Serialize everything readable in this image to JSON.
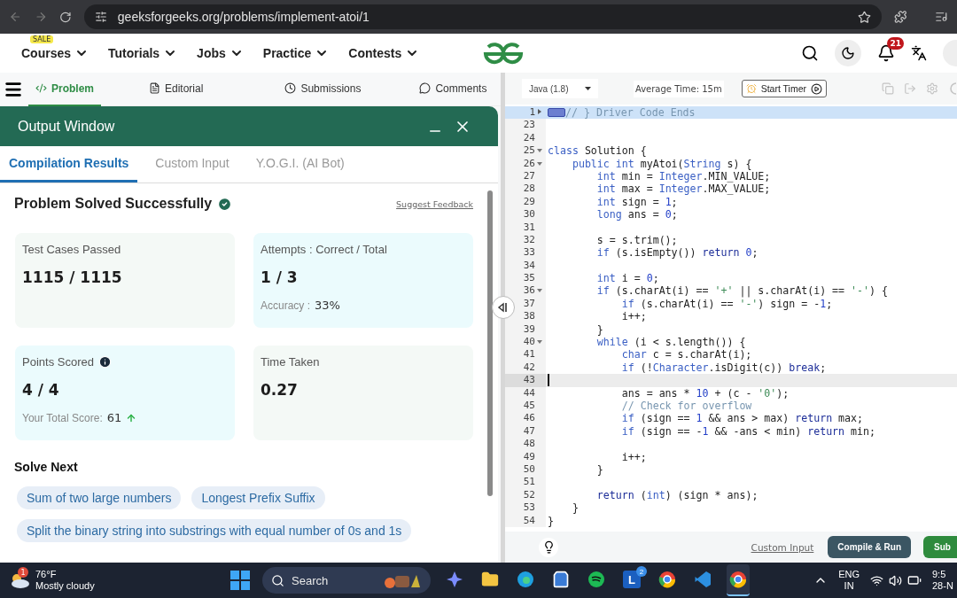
{
  "browser": {
    "url": "geeksforgeeks.org/problems/implement-atoi/1"
  },
  "site_nav": {
    "items": [
      {
        "label": "Courses",
        "badge": "SALE"
      },
      {
        "label": "Tutorials"
      },
      {
        "label": "Jobs"
      },
      {
        "label": "Practice"
      },
      {
        "label": "Contests"
      }
    ],
    "notification_count": "21"
  },
  "problem_tabs": [
    {
      "label": "Problem",
      "kind": "code",
      "selected": true
    },
    {
      "label": "Editorial",
      "kind": "document",
      "selected": false
    },
    {
      "label": "Submissions",
      "kind": "clock",
      "selected": false
    },
    {
      "label": "Comments",
      "kind": "chat",
      "selected": false
    }
  ],
  "output_window": {
    "title": "Output Window",
    "tabs": [
      {
        "label": "Compilation Results",
        "selected": true
      },
      {
        "label": "Custom Input",
        "selected": false
      },
      {
        "label": "Y.O.G.I. (AI Bot)",
        "selected": false
      }
    ],
    "heading": "Problem Solved Successfully",
    "feedback_link": "Suggest Feedback",
    "cards": [
      {
        "label": "Test Cases Passed",
        "value": "1115 / 1115",
        "color": "#f4f9f6"
      },
      {
        "label": "Attempts : Correct / Total",
        "value": "1 / 3",
        "footer_label": "Accuracy :",
        "footer_value": "33%",
        "color": "#ebfbfd"
      },
      {
        "label": "Points Scored",
        "info": true,
        "value": "4 / 4",
        "footer_label": "Your Total Score:",
        "footer_value": "61",
        "rising": true,
        "color": "#ebfbfd"
      },
      {
        "label": "Time Taken",
        "value": "0.27",
        "color": "#f4f9f6"
      }
    ],
    "solve_next": {
      "title": "Solve Next",
      "items": [
        "Sum of two large numbers",
        "Longest Prefix Suffix",
        "Split the binary string into substrings with equal number of 0s and 1s"
      ]
    }
  },
  "editor": {
    "language": "Java (1.8)",
    "average_time": "Average Time: 15m",
    "timer_button": "Start Timer",
    "lines": [
      {
        "number": "1",
        "folded": true,
        "selected": true,
        "parts": [
          {
            "kind": "comment",
            "text": "// } Driver Code Ends"
          }
        ]
      },
      {
        "number": "23"
      },
      {
        "number": "24"
      },
      {
        "number": "25",
        "folded": false,
        "parts": [
          {
            "kind": "keyword",
            "text": "class"
          },
          {
            "kind": "plain",
            "text": " Solution {"
          }
        ]
      },
      {
        "number": "26",
        "folded": false,
        "parts": [
          {
            "kind": "keyword",
            "text": "    public int"
          },
          {
            "kind": "plain",
            "text": " myAtoi("
          },
          {
            "kind": "keyword",
            "text": "String"
          },
          {
            "kind": "plain",
            "text": " s) {"
          }
        ]
      },
      {
        "number": "27",
        "parts": [
          {
            "kind": "keyword",
            "text": "        int"
          },
          {
            "kind": "plain",
            "text": " min = "
          },
          {
            "kind": "keyword",
            "text": "Integer"
          },
          {
            "kind": "plain",
            "text": ".MIN_VALUE;"
          }
        ]
      },
      {
        "number": "28",
        "parts": [
          {
            "kind": "keyword",
            "text": "        int"
          },
          {
            "kind": "plain",
            "text": " max = "
          },
          {
            "kind": "keyword",
            "text": "Integer"
          },
          {
            "kind": "plain",
            "text": ".MAX_VALUE;"
          }
        ]
      },
      {
        "number": "29",
        "parts": [
          {
            "kind": "keyword",
            "text": "        int"
          },
          {
            "kind": "plain",
            "text": " sign = "
          },
          {
            "kind": "number",
            "text": "1"
          },
          {
            "kind": "plain",
            "text": ";"
          }
        ]
      },
      {
        "number": "30",
        "parts": [
          {
            "kind": "keyword",
            "text": "        long"
          },
          {
            "kind": "plain",
            "text": " ans = "
          },
          {
            "kind": "number",
            "text": "0"
          },
          {
            "kind": "plain",
            "text": ";"
          }
        ]
      },
      {
        "number": "31"
      },
      {
        "number": "32",
        "parts": [
          {
            "kind": "plain",
            "text": "        s = s.trim();"
          }
        ]
      },
      {
        "number": "33",
        "parts": [
          {
            "kind": "keyword",
            "text": "        if"
          },
          {
            "kind": "plain",
            "text": " (s.isEmpty()) "
          },
          {
            "kind": "flow",
            "text": "return"
          },
          {
            "kind": "number",
            "text": " 0"
          },
          {
            "kind": "plain",
            "text": ";"
          }
        ]
      },
      {
        "number": "34"
      },
      {
        "number": "35",
        "parts": [
          {
            "kind": "keyword",
            "text": "        int"
          },
          {
            "kind": "plain",
            "text": " i = "
          },
          {
            "kind": "number",
            "text": "0"
          },
          {
            "kind": "plain",
            "text": ";"
          }
        ]
      },
      {
        "number": "36",
        "folded": false,
        "parts": [
          {
            "kind": "keyword",
            "text": "        if"
          },
          {
            "kind": "plain",
            "text": " (s.charAt(i) == "
          },
          {
            "kind": "string",
            "text": "'+'"
          },
          {
            "kind": "plain",
            "text": " || s.charAt(i) == "
          },
          {
            "kind": "string",
            "text": "'-'"
          },
          {
            "kind": "plain",
            "text": ") {"
          }
        ]
      },
      {
        "number": "37",
        "parts": [
          {
            "kind": "keyword",
            "text": "            if"
          },
          {
            "kind": "plain",
            "text": " (s.charAt(i) == "
          },
          {
            "kind": "string",
            "text": "'-'"
          },
          {
            "kind": "plain",
            "text": ") sign = -"
          },
          {
            "kind": "number",
            "text": "1"
          },
          {
            "kind": "plain",
            "text": ";"
          }
        ]
      },
      {
        "number": "38",
        "parts": [
          {
            "kind": "plain",
            "text": "            i++;"
          }
        ]
      },
      {
        "number": "39",
        "parts": [
          {
            "kind": "plain",
            "text": "        }"
          }
        ]
      },
      {
        "number": "40",
        "folded": false,
        "parts": [
          {
            "kind": "keyword",
            "text": "        while"
          },
          {
            "kind": "plain",
            "text": " (i < s.length()) {"
          }
        ]
      },
      {
        "number": "41",
        "parts": [
          {
            "kind": "keyword",
            "text": "            char"
          },
          {
            "kind": "plain",
            "text": " c = s.charAt(i);"
          }
        ]
      },
      {
        "number": "42",
        "parts": [
          {
            "kind": "keyword",
            "text": "            if"
          },
          {
            "kind": "plain",
            "text": " (!"
          },
          {
            "kind": "keyword",
            "text": "Character"
          },
          {
            "kind": "plain",
            "text": ".isDigit(c)) "
          },
          {
            "kind": "flow",
            "text": "break"
          },
          {
            "kind": "plain",
            "text": ";"
          }
        ]
      },
      {
        "number": "43",
        "current": true
      },
      {
        "number": "44",
        "parts": [
          {
            "kind": "plain",
            "text": "            ans = ans * "
          },
          {
            "kind": "number",
            "text": "10"
          },
          {
            "kind": "plain",
            "text": " + (c - "
          },
          {
            "kind": "string",
            "text": "'0'"
          },
          {
            "kind": "plain",
            "text": ");"
          }
        ]
      },
      {
        "number": "45",
        "parts": [
          {
            "kind": "comment",
            "text": "            // Check for overflow"
          }
        ]
      },
      {
        "number": "46",
        "parts": [
          {
            "kind": "keyword",
            "text": "            if"
          },
          {
            "kind": "plain",
            "text": " (sign == "
          },
          {
            "kind": "number",
            "text": "1"
          },
          {
            "kind": "plain",
            "text": " && ans > max) "
          },
          {
            "kind": "flow",
            "text": "return"
          },
          {
            "kind": "plain",
            "text": " max;"
          }
        ]
      },
      {
        "number": "47",
        "parts": [
          {
            "kind": "keyword",
            "text": "            if"
          },
          {
            "kind": "plain",
            "text": " (sign == -"
          },
          {
            "kind": "number",
            "text": "1"
          },
          {
            "kind": "plain",
            "text": " && -ans < min) "
          },
          {
            "kind": "flow",
            "text": "return"
          },
          {
            "kind": "plain",
            "text": " min;"
          }
        ]
      },
      {
        "number": "48"
      },
      {
        "number": "49",
        "parts": [
          {
            "kind": "plain",
            "text": "            i++;"
          }
        ]
      },
      {
        "number": "50",
        "parts": [
          {
            "kind": "plain",
            "text": "        }"
          }
        ]
      },
      {
        "number": "51"
      },
      {
        "number": "52",
        "parts": [
          {
            "kind": "flow",
            "text": "        return"
          },
          {
            "kind": "plain",
            "text": " ("
          },
          {
            "kind": "keyword",
            "text": "int"
          },
          {
            "kind": "plain",
            "text": ") (sign * ans);"
          }
        ]
      },
      {
        "number": "53",
        "parts": [
          {
            "kind": "plain",
            "text": "    }"
          }
        ]
      },
      {
        "number": "54",
        "parts": [
          {
            "kind": "plain",
            "text": "}"
          }
        ]
      }
    ],
    "custom_input_link": "Custom Input",
    "compile_button": "Compile & Run",
    "submit_button": "Sub"
  },
  "taskbar": {
    "weather": {
      "temperature": "76°F",
      "condition": "Mostly cloudy",
      "badge": "1"
    },
    "search_placeholder": "Search",
    "apps": [
      {
        "kind": "sparkle",
        "active": false
      },
      {
        "kind": "folder",
        "active": false
      },
      {
        "kind": "swirl",
        "active": false
      },
      {
        "kind": "bag",
        "active": false
      },
      {
        "kind": "music",
        "active": false
      },
      {
        "kind": "letter",
        "letter": "L",
        "badge": "2",
        "active": false
      },
      {
        "kind": "browser",
        "active": false
      },
      {
        "kind": "code",
        "active": false
      },
      {
        "kind": "browser",
        "active": true
      }
    ],
    "language": "ENG",
    "region": "IN",
    "time": "9:5",
    "date": "28-N"
  }
}
